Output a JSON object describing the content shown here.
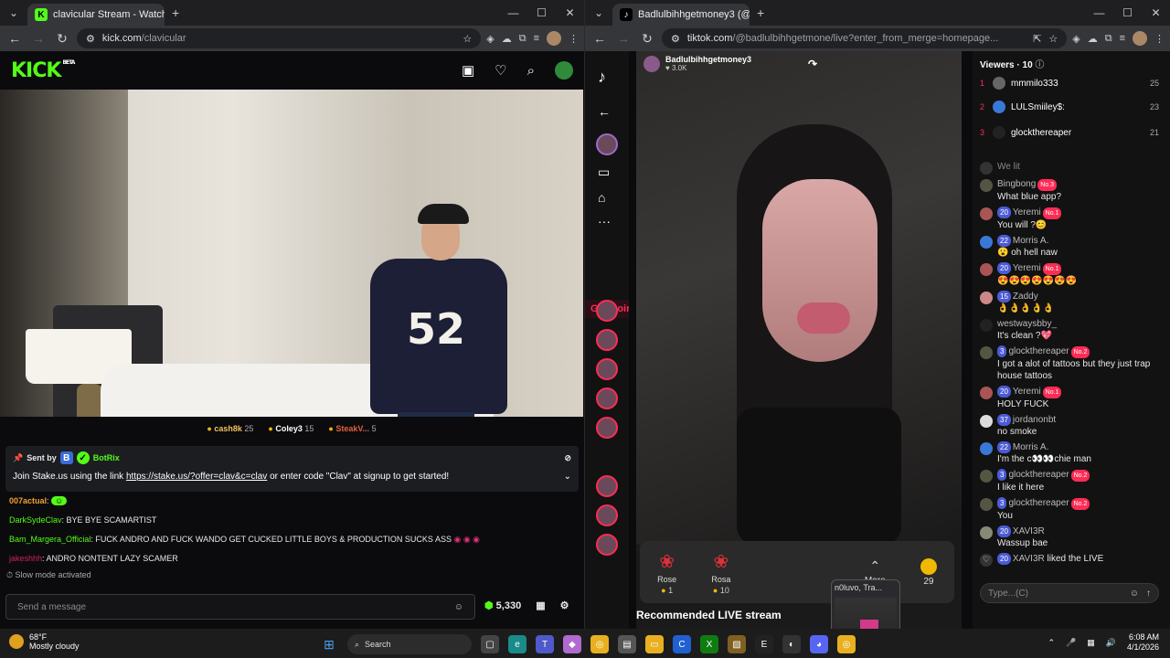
{
  "left_window": {
    "tab_title": "clavicular Stream - Watch Live",
    "url_host": "kick.com",
    "url_path": "/clavicular",
    "brand": "KICK",
    "brand_badge": "BETA",
    "gifters": [
      {
        "name": "cash8k",
        "count": "25"
      },
      {
        "name": "Coley3",
        "count": "15"
      },
      {
        "name": "SteakV...",
        "count": "5"
      }
    ],
    "pinned": {
      "sent_by_label": "Sent by",
      "sender": "BotRix",
      "text_before": "Join Stake.us using the link ",
      "link": "https://stake.us/?offer=clav&c=clav",
      "text_after": " or enter code \"Clav\" at signup to get started!"
    },
    "chat": [
      {
        "user": "007actual",
        "msg": "",
        "color": "#f0a030"
      },
      {
        "user": "DarkSydeClav",
        "msg": "BYE BYE SCAMARTIST",
        "color": "#53fc18"
      },
      {
        "user": "Bam_Margera_Official",
        "msg": "FUCK ANDRO AND FUCK WANDO GET CUCKED LITTLE BOYS & PRODUCTION SUCKS ASS",
        "color": "#53fc18"
      },
      {
        "user": "jakeshhh",
        "msg": "ANDRO NONTENT LAZY SCAMER",
        "color": "#d02060"
      }
    ],
    "slow_mode": "Slow mode activated",
    "input_placeholder": "Send a message",
    "balance": "5,330",
    "watermark": "mWg"
  },
  "right_window": {
    "tab_title": "Badlulbihhgetmoney3 (@b",
    "url_host": "tiktok.com",
    "url_path": "/@badlulbihhgetmone/live?enter_from_merge=homepage...",
    "creator": "Badlulbihhgetmoney3",
    "likes": "3.0K",
    "get_coins": "Get Coins",
    "gifts": [
      {
        "name": "Rose",
        "price": "1"
      },
      {
        "name": "Rosa",
        "price": "10"
      }
    ],
    "more_label": "More",
    "coin_count": "29",
    "recommended": "Recommended LIVE stream",
    "popup_title": "n0luvo, Tra...",
    "viewers_label": "Viewers",
    "viewers_count": "10",
    "top_viewers": [
      {
        "rank": "1",
        "name": "mmmilo333",
        "score": "25"
      },
      {
        "rank": "2",
        "name": "LULSmiiley$:",
        "score": "23"
      },
      {
        "rank": "3",
        "name": "glockthereaper",
        "score": "21"
      }
    ],
    "chat": [
      {
        "user": "",
        "msg": "We lit",
        "lv": "",
        "rank": ""
      },
      {
        "user": "Bingbong",
        "msg": "What blue app?",
        "lv": "",
        "rank": "No.3"
      },
      {
        "user": "Yeremi",
        "msg": "You will ?😊",
        "lv": "20",
        "rank": "No.1"
      },
      {
        "user": "Morris A.",
        "msg": "😮 oh hell naw",
        "lv": "22",
        "rank": ""
      },
      {
        "user": "Yeremi",
        "msg": "😍😍😍😍😍😍😍",
        "lv": "20",
        "rank": "No.1"
      },
      {
        "user": "Zaddy",
        "msg": "👌👌👌👌👌",
        "lv": "15",
        "rank": ""
      },
      {
        "user": "westwaysbby_",
        "msg": "It's clean ?💖",
        "lv": "",
        "rank": ""
      },
      {
        "user": "glockthereaper",
        "msg": "I got a alot of tattoos but they just trap house tattoos",
        "lv": "3",
        "rank": "No.2"
      },
      {
        "user": "Yeremi",
        "msg": "HOLY FUCK",
        "lv": "20",
        "rank": "No.1"
      },
      {
        "user": "jordanonbt",
        "msg": "no smoke",
        "lv": "37",
        "rank": ""
      },
      {
        "user": "Morris A.",
        "msg": "I'm the c👀👀chie man",
        "lv": "22",
        "rank": ""
      },
      {
        "user": "glockthereaper",
        "msg": "I like it here",
        "lv": "3",
        "rank": "No.2"
      },
      {
        "user": "glockthereaper",
        "msg": "You",
        "lv": "3",
        "rank": "No.2"
      },
      {
        "user": "XAVI3R",
        "msg": "Wassup bae",
        "lv": "20",
        "rank": ""
      },
      {
        "user": "XAVI3R",
        "msg": "liked the LIVE",
        "lv": "20",
        "rank": ""
      }
    ],
    "input_placeholder": "Type...(C)"
  },
  "taskbar": {
    "temp": "68°F",
    "weather": "Mostly cloudy",
    "search": "Search",
    "time": "6:08 AM",
    "date": "4/1/2026"
  },
  "colors": {
    "kick_green": "#53fc18",
    "tiktok_red": "#fe2c55"
  }
}
